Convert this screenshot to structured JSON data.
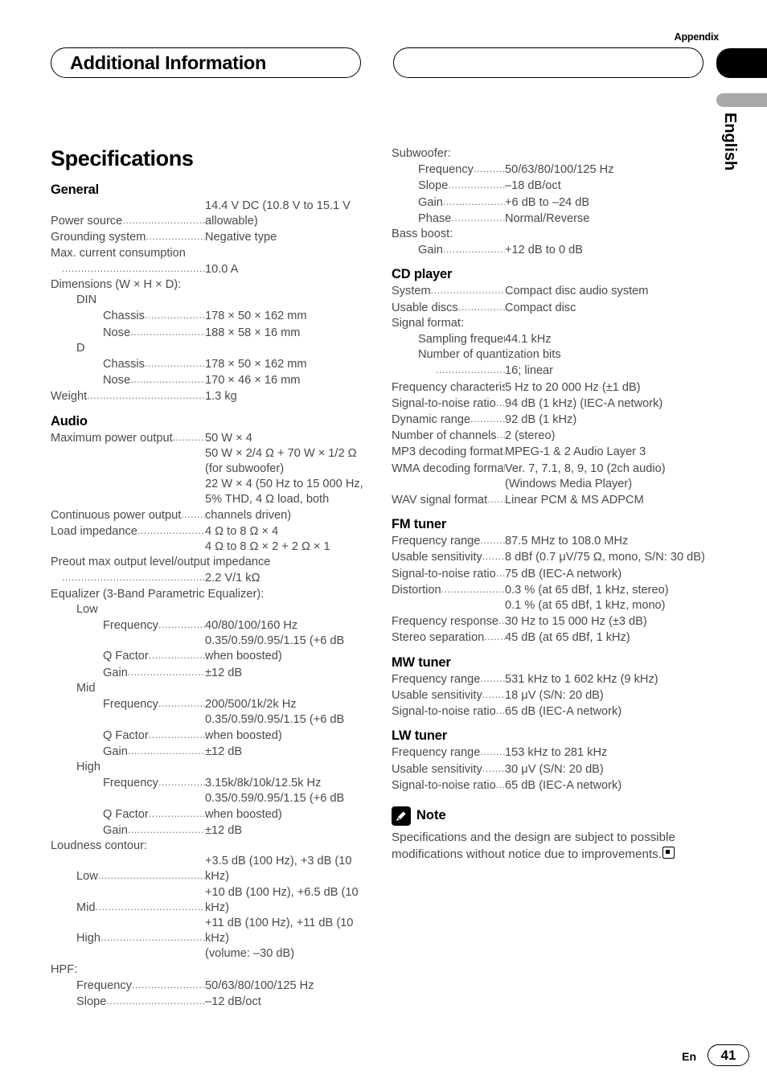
{
  "header": {
    "appendix_label": "Appendix",
    "chapter_title": "Additional Information",
    "language_tab": "English"
  },
  "page_title": "Specifications",
  "footer": {
    "language_code": "En",
    "page_number": "41"
  },
  "note": {
    "icon": "pencil-icon",
    "title": "Note",
    "body": "Specifications and the design are subject to possible modifications without notice due to improvements."
  },
  "left_column": {
    "sections": [
      {
        "heading": "General",
        "rows": [
          {
            "type": "spec",
            "indent": 0,
            "label": "Power source",
            "dots": true,
            "value": "14.4 V DC (10.8 V to 15.1 V allowable)"
          },
          {
            "type": "spec",
            "indent": 0,
            "label": "Grounding system",
            "dots": true,
            "value": "Negative type"
          },
          {
            "type": "plain",
            "indent": 0,
            "text": "Max. current consumption"
          },
          {
            "type": "spec",
            "indent": 3,
            "label": "",
            "dots": true,
            "value": "10.0 A"
          },
          {
            "type": "plain",
            "indent": 0,
            "text": "Dimensions (W × H × D):"
          },
          {
            "type": "plain",
            "indent": 1,
            "text": "DIN"
          },
          {
            "type": "spec",
            "indent": 2,
            "label": "Chassis",
            "dots": true,
            "value": "178 × 50 × 162 mm"
          },
          {
            "type": "spec",
            "indent": 2,
            "label": "Nose",
            "dots": true,
            "value": "188 × 58 × 16 mm"
          },
          {
            "type": "plain",
            "indent": 1,
            "text": "D"
          },
          {
            "type": "spec",
            "indent": 2,
            "label": "Chassis",
            "dots": true,
            "value": "178 × 50 × 162 mm"
          },
          {
            "type": "spec",
            "indent": 2,
            "label": "Nose",
            "dots": true,
            "value": "170 × 46 × 16 mm"
          },
          {
            "type": "spec",
            "indent": 0,
            "label": "Weight",
            "dots": true,
            "value": "1.3 kg"
          }
        ]
      },
      {
        "heading": "Audio",
        "rows": [
          {
            "type": "spec",
            "indent": 0,
            "label": "Maximum power output",
            "dots": true,
            "value": "50 W × 4"
          },
          {
            "type": "cont",
            "text": "50 W × 2/4 Ω + 70 W × 1/2 Ω (for subwoofer)"
          },
          {
            "type": "spec",
            "indent": 0,
            "label": "Continuous power output",
            "dots": true,
            "value": "22 W × 4 (50 Hz to 15 000 Hz, 5% THD, 4 Ω load, both channels driven)"
          },
          {
            "type": "spec",
            "indent": 0,
            "label": "Load impedance",
            "dots": true,
            "value": "4 Ω to 8 Ω × 4"
          },
          {
            "type": "cont",
            "text": "4 Ω to 8 Ω × 2 + 2 Ω × 1"
          },
          {
            "type": "plain",
            "indent": 0,
            "text": "Preout max output level/output impedance"
          },
          {
            "type": "spec",
            "indent": 3,
            "label": "",
            "dots": true,
            "value": "2.2 V/1 kΩ"
          },
          {
            "type": "plain",
            "indent": 0,
            "text": "Equalizer (3-Band Parametric Equalizer):"
          },
          {
            "type": "plain",
            "indent": 1,
            "text": "Low"
          },
          {
            "type": "spec",
            "indent": 2,
            "label": "Frequency",
            "dots": true,
            "value": "40/80/100/160 Hz"
          },
          {
            "type": "spec",
            "indent": 2,
            "label": "Q Factor",
            "dots": true,
            "value": "0.35/0.59/0.95/1.15 (+6 dB when boosted)"
          },
          {
            "type": "spec",
            "indent": 2,
            "label": "Gain",
            "dots": true,
            "value": "±12 dB"
          },
          {
            "type": "plain",
            "indent": 1,
            "text": "Mid"
          },
          {
            "type": "spec",
            "indent": 2,
            "label": "Frequency",
            "dots": true,
            "value": "200/500/1k/2k Hz"
          },
          {
            "type": "spec",
            "indent": 2,
            "label": "Q Factor",
            "dots": true,
            "value": "0.35/0.59/0.95/1.15 (+6 dB when boosted)"
          },
          {
            "type": "spec",
            "indent": 2,
            "label": "Gain",
            "dots": true,
            "value": "±12 dB"
          },
          {
            "type": "plain",
            "indent": 1,
            "text": "High"
          },
          {
            "type": "spec",
            "indent": 2,
            "label": "Frequency",
            "dots": true,
            "value": "3.15k/8k/10k/12.5k Hz"
          },
          {
            "type": "spec",
            "indent": 2,
            "label": "Q Factor",
            "dots": true,
            "value": "0.35/0.59/0.95/1.15 (+6 dB when boosted)"
          },
          {
            "type": "spec",
            "indent": 2,
            "label": "Gain",
            "dots": true,
            "value": "±12 dB"
          },
          {
            "type": "plain",
            "indent": 0,
            "text": "Loudness contour:"
          },
          {
            "type": "spec",
            "indent": 1,
            "label": "Low",
            "dots": true,
            "value": "+3.5 dB (100 Hz), +3 dB (10 kHz)"
          },
          {
            "type": "spec",
            "indent": 1,
            "label": "Mid",
            "dots": true,
            "value": "+10 dB (100 Hz), +6.5 dB (10 kHz)"
          },
          {
            "type": "spec",
            "indent": 1,
            "label": "High",
            "dots": true,
            "value": "+11 dB (100 Hz), +11 dB (10 kHz)"
          },
          {
            "type": "cont",
            "text": "(volume: –30 dB)"
          },
          {
            "type": "plain",
            "indent": 0,
            "text": "HPF:"
          },
          {
            "type": "spec",
            "indent": 1,
            "label": "Frequency",
            "dots": true,
            "value": "50/63/80/100/125 Hz"
          },
          {
            "type": "spec",
            "indent": 1,
            "label": "Slope",
            "dots": true,
            "value": "–12 dB/oct"
          }
        ]
      }
    ]
  },
  "right_column": {
    "sections": [
      {
        "heading": "",
        "rows": [
          {
            "type": "plain",
            "indent": 0,
            "text": "Subwoofer:"
          },
          {
            "type": "spec",
            "indent": 1,
            "label": "Frequency",
            "dots": true,
            "value": "50/63/80/100/125 Hz"
          },
          {
            "type": "spec",
            "indent": 1,
            "label": "Slope",
            "dots": true,
            "value": "–18 dB/oct"
          },
          {
            "type": "spec",
            "indent": 1,
            "label": "Gain",
            "dots": true,
            "value": "+6 dB to –24 dB"
          },
          {
            "type": "spec",
            "indent": 1,
            "label": "Phase",
            "dots": true,
            "value": "Normal/Reverse"
          },
          {
            "type": "plain",
            "indent": 0,
            "text": "Bass boost:"
          },
          {
            "type": "spec",
            "indent": 1,
            "label": "Gain",
            "dots": true,
            "value": "+12 dB to 0 dB"
          }
        ]
      },
      {
        "heading": "CD player",
        "rows": [
          {
            "type": "spec",
            "indent": 0,
            "label": "System",
            "dots": true,
            "value": "Compact disc audio system"
          },
          {
            "type": "spec",
            "indent": 0,
            "label": "Usable discs",
            "dots": true,
            "value": "Compact disc"
          },
          {
            "type": "plain",
            "indent": 0,
            "text": "Signal format:"
          },
          {
            "type": "spec",
            "indent": 1,
            "label": "Sampling frequency",
            "dots": true,
            "value": "44.1 kHz"
          },
          {
            "type": "plain",
            "indent": 1,
            "text": "Number of quantization bits"
          },
          {
            "type": "spec",
            "indent": 2,
            "label": "",
            "dots": true,
            "value": "16; linear"
          },
          {
            "type": "spec",
            "indent": 0,
            "label": "Frequency characteristics",
            "dots": true,
            "value": "5 Hz to 20 000 Hz (±1 dB)"
          },
          {
            "type": "spec",
            "indent": 0,
            "label": "Signal-to-noise ratio",
            "dots": true,
            "value": "94 dB (1 kHz) (IEC-A network)"
          },
          {
            "type": "spec",
            "indent": 0,
            "label": "Dynamic range",
            "dots": true,
            "value": "92 dB (1 kHz)"
          },
          {
            "type": "spec",
            "indent": 0,
            "label": "Number of channels",
            "dots": true,
            "value": "2 (stereo)"
          },
          {
            "type": "spec",
            "indent": 0,
            "label": "MP3 decoding format",
            "dots": true,
            "value": "MPEG-1 & 2 Audio Layer 3"
          },
          {
            "type": "spec",
            "indent": 0,
            "label": "WMA decoding format",
            "dots": true,
            "value": "Ver. 7, 7.1, 8, 9, 10 (2ch audio)"
          },
          {
            "type": "cont",
            "text": "(Windows Media Player)"
          },
          {
            "type": "spec",
            "indent": 0,
            "label": "WAV signal format",
            "dots": true,
            "value": "Linear PCM & MS ADPCM"
          }
        ]
      },
      {
        "heading": "FM tuner",
        "rows": [
          {
            "type": "spec",
            "indent": 0,
            "label": "Frequency range",
            "dots": true,
            "value": "87.5 MHz to 108.0 MHz"
          },
          {
            "type": "spec",
            "indent": 0,
            "label": "Usable sensitivity",
            "dots": true,
            "value": "8 dBf (0.7 μV/75 Ω, mono, S/N: 30 dB)"
          },
          {
            "type": "spec",
            "indent": 0,
            "label": "Signal-to-noise ratio",
            "dots": true,
            "value": "75 dB (IEC-A network)"
          },
          {
            "type": "spec",
            "indent": 0,
            "label": "Distortion",
            "dots": true,
            "value": "0.3 % (at 65 dBf, 1 kHz, stereo)"
          },
          {
            "type": "cont",
            "text": "0.1 % (at 65 dBf, 1 kHz, mono)"
          },
          {
            "type": "spec",
            "indent": 0,
            "label": "Frequency response",
            "dots": true,
            "value": "30 Hz to 15 000 Hz (±3 dB)"
          },
          {
            "type": "spec",
            "indent": 0,
            "label": "Stereo separation",
            "dots": true,
            "value": "45 dB (at 65 dBf, 1 kHz)"
          }
        ]
      },
      {
        "heading": "MW tuner",
        "rows": [
          {
            "type": "spec",
            "indent": 0,
            "label": "Frequency range",
            "dots": true,
            "value": "531 kHz to 1 602 kHz (9 kHz)"
          },
          {
            "type": "spec",
            "indent": 0,
            "label": "Usable sensitivity",
            "dots": true,
            "value": "18 μV (S/N: 20 dB)"
          },
          {
            "type": "spec",
            "indent": 0,
            "label": "Signal-to-noise ratio",
            "dots": true,
            "value": "65 dB (IEC-A network)"
          }
        ]
      },
      {
        "heading": "LW tuner",
        "rows": [
          {
            "type": "spec",
            "indent": 0,
            "label": "Frequency range",
            "dots": true,
            "value": "153 kHz to 281 kHz"
          },
          {
            "type": "spec",
            "indent": 0,
            "label": "Usable sensitivity",
            "dots": true,
            "value": "30 μV (S/N: 20 dB)"
          },
          {
            "type": "spec",
            "indent": 0,
            "label": "Signal-to-noise ratio",
            "dots": true,
            "value": "65 dB (IEC-A network)"
          }
        ]
      }
    ]
  }
}
